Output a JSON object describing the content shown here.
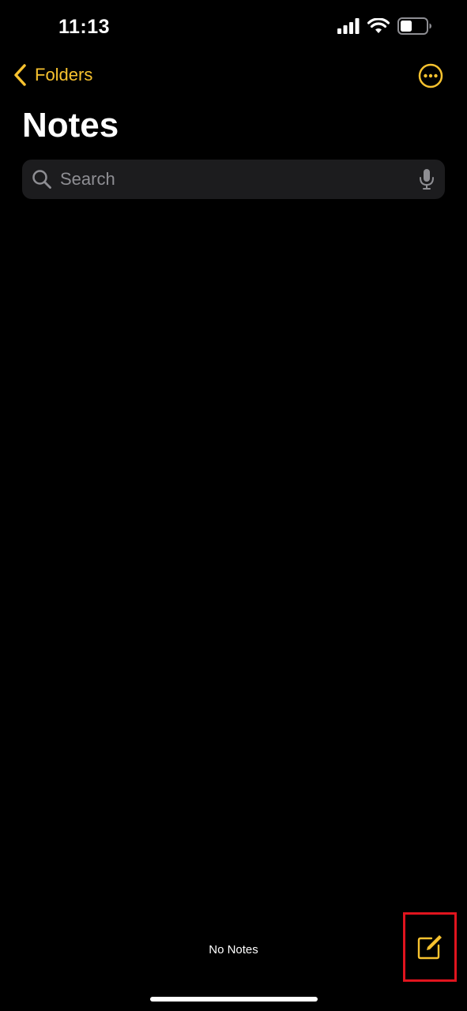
{
  "status_bar": {
    "time": "11:13",
    "signal_icon": "cellular-signal-icon",
    "wifi_icon": "wifi-icon",
    "battery_icon": "battery-icon",
    "battery_level": 0.45
  },
  "nav": {
    "back_label": "Folders",
    "back_icon": "chevron-left-icon",
    "more_icon": "ellipsis-circle-icon"
  },
  "title": "Notes",
  "search": {
    "placeholder": "Search",
    "value": "",
    "search_icon": "magnifying-glass-icon",
    "mic_icon": "microphone-icon"
  },
  "notes": [],
  "toolbar": {
    "count_label": "No Notes",
    "compose_icon": "compose-icon",
    "compose_highlight_color": "#e0141e"
  },
  "colors": {
    "accent": "#f7c22f",
    "background": "#000000",
    "search_background": "#1c1c1e",
    "placeholder": "#8e8e93"
  }
}
